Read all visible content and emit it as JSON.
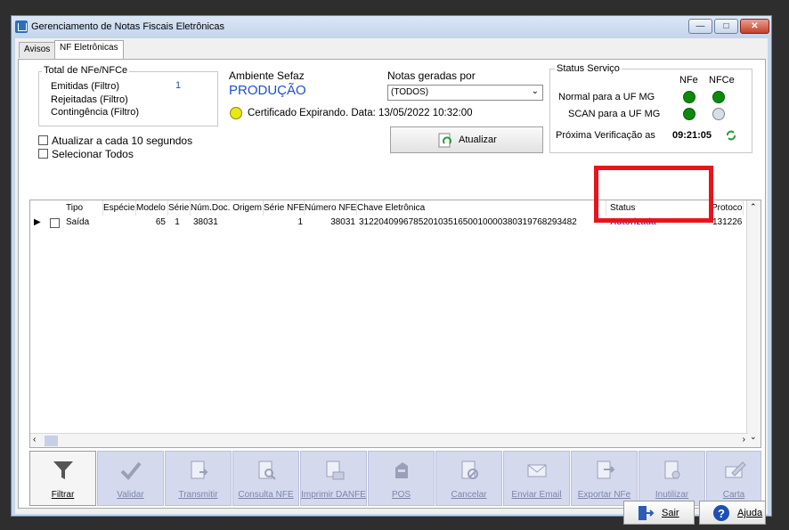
{
  "window": {
    "title": "Gerenciamento de Notas Fiscais Eletrônicas",
    "minimize": "—",
    "maximize": "□",
    "close": "✕"
  },
  "tabs": [
    {
      "label": "Avisos"
    },
    {
      "label": "NF Eletrônicas"
    }
  ],
  "totals": {
    "title": "Total de NFe/NFCe",
    "emitidas": "Emitidas (Filtro)",
    "emitidas_count": "1",
    "rejeitadas": "Rejeitadas (Filtro)",
    "contingencia": "Contingência (Filtro)"
  },
  "ambiente": {
    "title": "Ambiente Sefaz",
    "value": "PRODUÇÃO",
    "certificado": "Certificado Expirando. Data: 13/05/2022 10:32:00"
  },
  "notas": {
    "title": "Notas geradas por",
    "selected": "(TODOS)",
    "atualizar": "Atualizar"
  },
  "options": {
    "auto_refresh": "Atualizar a cada 10 segundos",
    "select_all": "Selecionar Todos"
  },
  "status_servico": {
    "title": "Status Serviço",
    "col_nfe": "NFe",
    "col_nfce": "NFCe",
    "normal": "Normal para a UF MG",
    "scan": "SCAN para a UF MG",
    "proxima": "Próxima Verificação as",
    "time": "09:21:05"
  },
  "grid": {
    "headers": [
      "Tipo",
      "Espécie",
      "Modelo",
      "Série",
      "Núm.Doc. Origem",
      "Série NFE",
      "Número NFE",
      "Chave Eletrônica",
      "Status",
      "Protoco"
    ],
    "row": {
      "tipo": "Saída",
      "especie": "",
      "modelo": "65",
      "serie": "1",
      "num_doc": "38031",
      "serie_nfe": "1",
      "numero_nfe": "38031",
      "chave": "31220409967852010351650010000380319768293482",
      "status": "Autorizada",
      "protocolo": "131226"
    }
  },
  "toolbar": {
    "filtrar": "Filtrar",
    "validar": "Validar",
    "transmitir": "Transmitir",
    "consulta": "Consulta NFE",
    "imprimir": "Imprimir DANFE",
    "pos": "POS",
    "cancelar": "Cancelar",
    "email": "Enviar Email",
    "exportar": "Exportar NFe",
    "inutilizar": "Inutilizar",
    "carta": "Carta"
  },
  "footer": {
    "sair": "Sair",
    "ajuda": "Ajuda"
  },
  "colors": {
    "accent_blue": "#1f4fd0",
    "status_green": "#0d8a0d",
    "highlight_red": "#e8141c"
  }
}
